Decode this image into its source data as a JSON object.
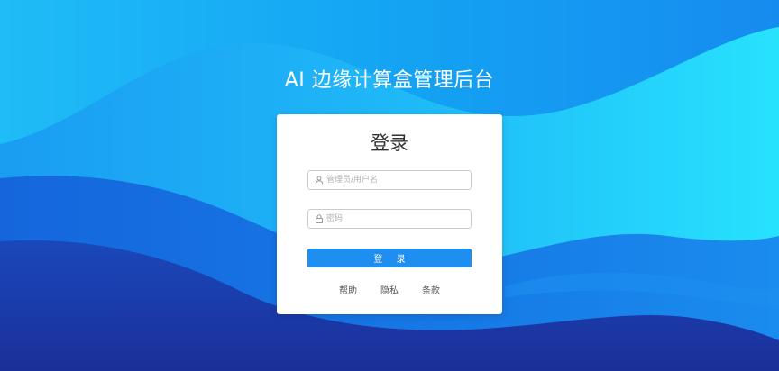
{
  "app": {
    "title": "AI 边缘计算盒管理后台"
  },
  "login": {
    "heading": "登录",
    "username": {
      "placeholder": "管理员/用户名",
      "value": "",
      "icon": "user-icon"
    },
    "password": {
      "placeholder": "密码",
      "value": "",
      "icon": "lock-icon"
    },
    "submit_label": "登 录"
  },
  "footer": {
    "help": "帮助",
    "privacy": "隐私",
    "terms": "条款"
  },
  "colors": {
    "accent": "#1e8ff0",
    "background_light": "#26d6fb",
    "background_mid": "#168df0",
    "background_dark": "#1a3aa6"
  }
}
